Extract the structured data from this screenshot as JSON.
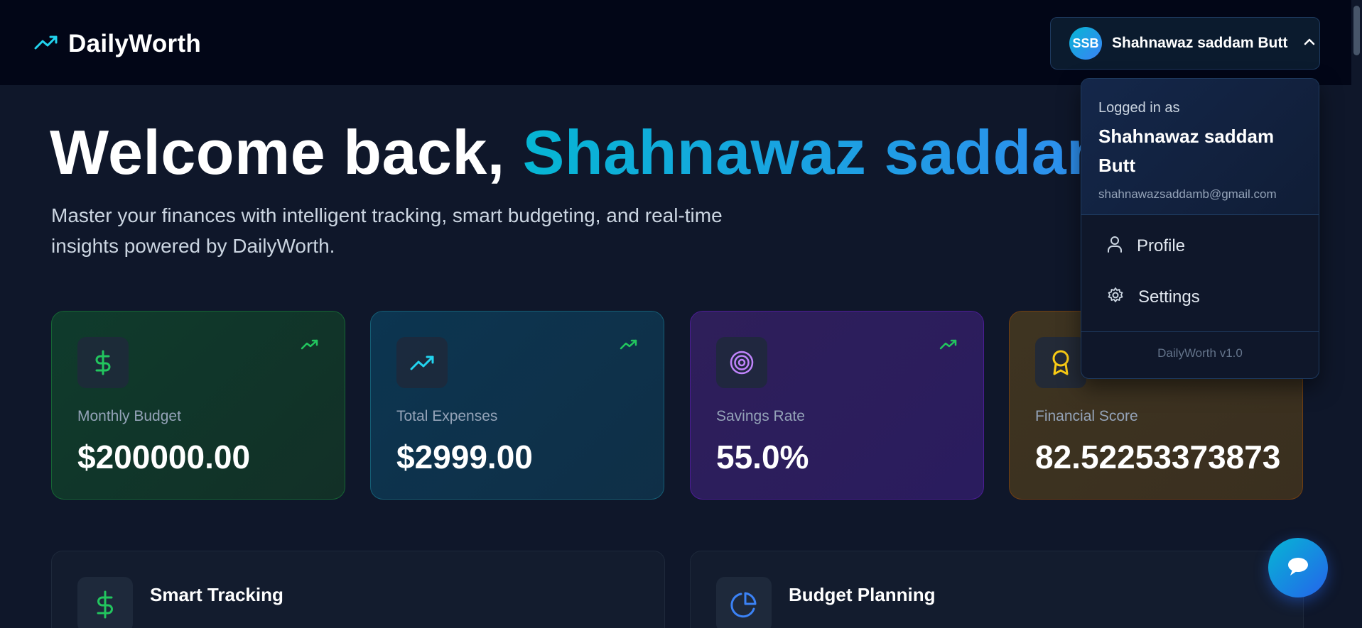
{
  "header": {
    "brand": "DailyWorth",
    "user": {
      "initials": "SSB",
      "name": "Shahnawaz saddam Butt"
    }
  },
  "hero": {
    "greeting": "Welcome back, ",
    "name": "Shahnawaz saddam Butt",
    "subtitle": "Master your finances with intelligent tracking, smart budgeting, and real-time insights powered by DailyWorth."
  },
  "stats": [
    {
      "label": "Monthly Budget",
      "value": "$200000.00",
      "icon": "dollar-icon"
    },
    {
      "label": "Total Expenses",
      "value": "$2999.00",
      "icon": "trending-up-icon"
    },
    {
      "label": "Savings Rate",
      "value": "55.0%",
      "icon": "target-icon"
    },
    {
      "label": "Financial Score",
      "value": "82.52253373873",
      "icon": "award-icon"
    }
  ],
  "features": [
    {
      "title": "Smart Tracking",
      "icon": "dollar-icon"
    },
    {
      "title": "Budget Planning",
      "icon": "pie-chart-icon"
    }
  ],
  "dropdown": {
    "logged_in_label": "Logged in as",
    "name": "Shahnawaz saddam Butt",
    "email": "shahnawazsaddamb@gmail.com",
    "items": [
      {
        "label": "Profile",
        "icon": "user-icon"
      },
      {
        "label": "Settings",
        "icon": "gear-icon"
      }
    ],
    "version": "DailyWorth v1.0"
  },
  "colors": {
    "accent_cyan": "#06b6d4",
    "accent_blue": "#3b82f6",
    "trend_green": "#22c55e",
    "background": "#0f172a"
  }
}
